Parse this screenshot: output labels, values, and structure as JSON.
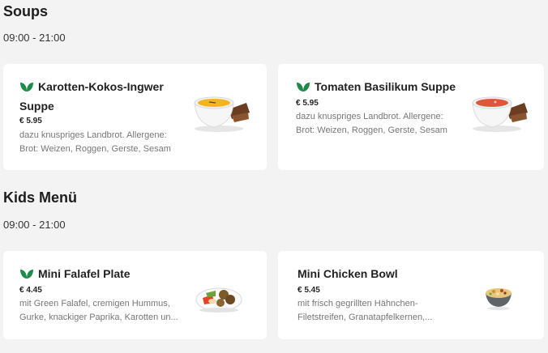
{
  "sections": [
    {
      "title": "Soups",
      "hours": "09:00 - 21:00",
      "items": [
        {
          "name": "Karotten-Kokos-Ingwer Suppe",
          "name_line1": "Karotten-Kokos-Ingwer",
          "name_line2": "Suppe",
          "price": "€ 5.95",
          "desc_line1": "dazu knuspriges Landbrot. Allergene:",
          "desc_line2": "Brot: Weizen, Roggen, Gerste, Sesam",
          "vegan": true,
          "icon": "carrot-soup-image"
        },
        {
          "name": "Tomaten Basilikum Suppe",
          "price": "€ 5.95",
          "desc_line1": "dazu knuspriges Landbrot. Allergene:",
          "desc_line2": "Brot: Weizen, Roggen, Gerste, Sesam",
          "vegan": true,
          "icon": "tomato-soup-image"
        }
      ]
    },
    {
      "title": "Kids Menü",
      "hours": "09:00 - 21:00",
      "items": [
        {
          "name": "Mini Falafel Plate",
          "price": "€ 4.45",
          "desc_line1": "mit Green Falafel, cremigen Hummus,",
          "desc_line2": "Gurke, knackiger Paprika, Karotten un...",
          "vegan": true,
          "icon": "falafel-plate-image"
        },
        {
          "name": "Mini Chicken Bowl",
          "price": "€ 5.45",
          "desc_line1": "mit frisch gegrillten Hähnchen-",
          "desc_line2": "Filetstreifen, Granatapfelkernen,...",
          "vegan": false,
          "icon": "chicken-bowl-image"
        }
      ]
    }
  ],
  "colors": {
    "background": "#f4f3f3",
    "card": "#ffffff",
    "vegan_leaf": "#1f8a4a",
    "text": "#1d1d1d",
    "muted": "#777777"
  }
}
